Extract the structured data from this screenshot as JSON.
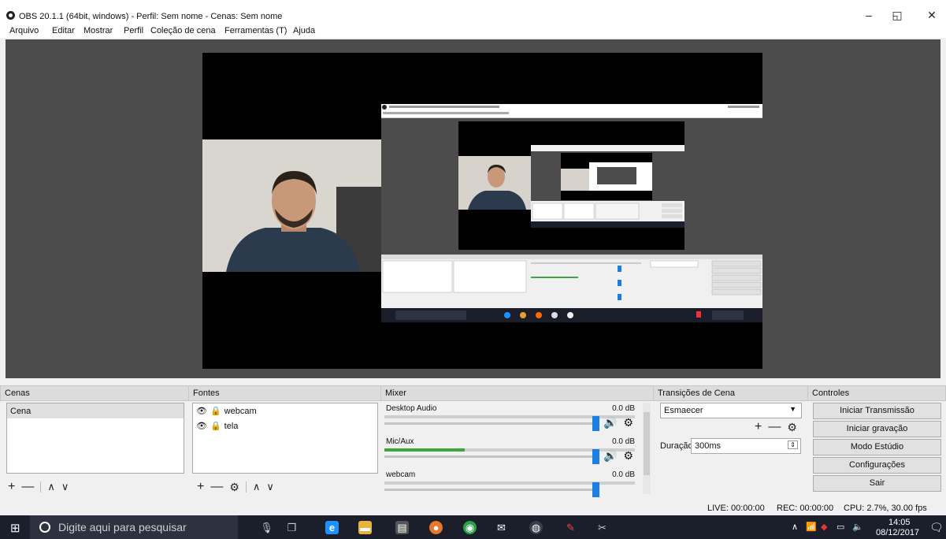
{
  "window": {
    "title": "OBS 20.1.1 (64bit, windows) - Perfil: Sem nome - Cenas: Sem nome",
    "minimize": "–",
    "maximize": "◱",
    "close": "✕"
  },
  "menu": [
    "Arquivo",
    "Editar",
    "Mostrar",
    "Perfil",
    "Coleção de cena",
    "Ferramentas (T)",
    "Ajuda"
  ],
  "docks": {
    "scenes": {
      "title": "Cenas",
      "items": [
        "Cena"
      ]
    },
    "sources": {
      "title": "Fontes",
      "items": [
        "webcam",
        "tela"
      ]
    },
    "mixer": {
      "title": "Mixer",
      "tracks": [
        {
          "name": "Desktop Audio",
          "db": "0.0 dB",
          "level": 0.0
        },
        {
          "name": "Mic/Aux",
          "db": "0.0 dB",
          "level": 0.32
        },
        {
          "name": "webcam",
          "db": "0.0 dB",
          "level": 0.0
        }
      ]
    },
    "transitions": {
      "title": "Transições de Cena",
      "selected": "Esmaecer",
      "duration_label": "Duração",
      "duration_value": "300ms"
    },
    "controls": {
      "title": "Controles",
      "buttons": [
        "Iniciar Transmissão",
        "Iniciar gravação",
        "Modo Estúdio",
        "Configurações",
        "Sair"
      ]
    }
  },
  "status": {
    "live": "LIVE: 00:00:00",
    "rec": "REC: 00:00:00",
    "cpu": "CPU: 2.7%, 30.00 fps"
  },
  "taskbar": {
    "search_placeholder": "Digite aqui para pesquisar",
    "time": "14:05",
    "date": "08/12/2017"
  },
  "colors": {
    "preview_bg": "#4c4c4c",
    "accent": "#1d7de0",
    "meter_green": "#3fa53f",
    "taskbar_bg": "#1b1f2b"
  }
}
